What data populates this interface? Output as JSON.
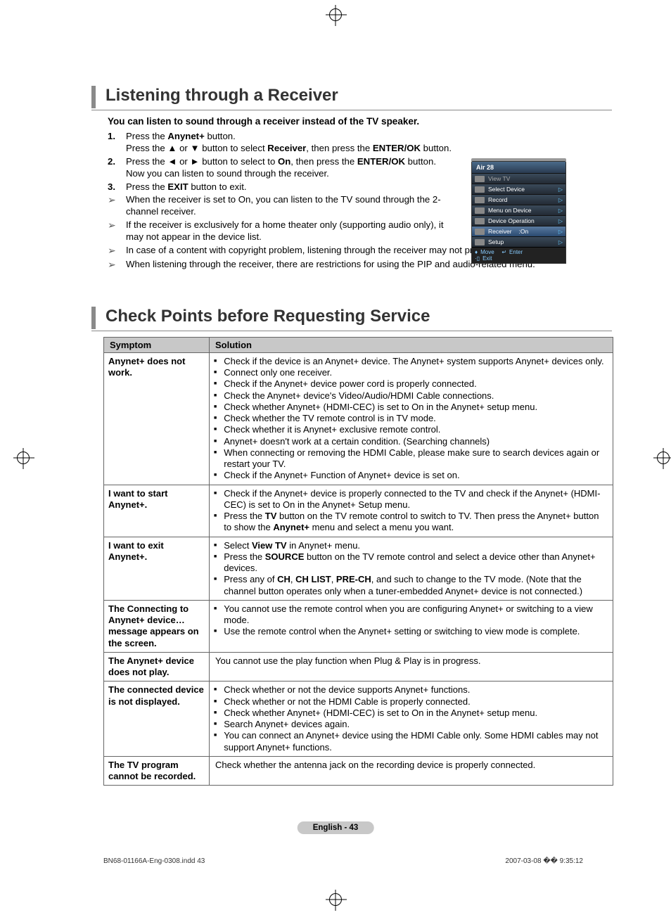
{
  "section1": {
    "title": "Listening through a Receiver",
    "intro": "You can listen to sound through a receiver instead of the TV speaker.",
    "steps": [
      {
        "num": "1.",
        "l1": "Press the ",
        "b1": "Anynet+",
        "l2": " button.",
        "l3": "Press the ▲ or ▼ button to select ",
        "b2": "Receiver",
        "l4": ", then press the ",
        "b3": "ENTER/OK",
        "l5": " button."
      },
      {
        "num": "2.",
        "l1": "Press the ◄ or ► button to select to ",
        "b1": "On",
        "l2": ", then press the ",
        "b2": "ENTER/OK",
        "l3": " button.",
        "l4": "Now you can listen to sound through the receiver."
      },
      {
        "num": "3.",
        "l1": "Press the ",
        "b1": "EXIT",
        "l2": " button to exit."
      }
    ],
    "notes": [
      "When the receiver is set to On, you can listen to the TV sound through the 2-channel receiver.",
      "If the receiver is exclusively for a home theater only (supporting audio only), it may not appear in the device list.",
      "In case of a content with copyright problem, listening through the receiver may not properly operate.",
      "When listening through the receiver, there are restrictions for using the PIP and audio-related menu."
    ]
  },
  "osd": {
    "title": "Air 28",
    "rows": [
      {
        "label": "View TV",
        "dim": true,
        "arrow": false
      },
      {
        "label": "Select Device",
        "arrow": true
      },
      {
        "label": "Record",
        "arrow": true
      },
      {
        "label": "Menu on Device",
        "arrow": true
      },
      {
        "label": "Device Operation",
        "arrow": true
      },
      {
        "label": "Receiver",
        "value": ":On",
        "arrow": true,
        "sel": true
      },
      {
        "label": "Setup",
        "arrow": true
      }
    ],
    "footer": {
      "move": "Move",
      "enter": "Enter",
      "exit": "Exit"
    }
  },
  "section2": {
    "title": "Check Points before Requesting Service",
    "th1": "Symptom",
    "th2": "Solution",
    "rows": [
      {
        "sym": "Anynet+ does not work.",
        "items": [
          "Check if the device is an Anynet+ device. The Anynet+ system supports Anynet+ devices only.",
          "Connect only one receiver.",
          "Check if the Anynet+ device power cord is properly connected.",
          "Check the Anynet+ device's Video/Audio/HDMI Cable connections.",
          "Check whether Anynet+ (HDMI-CEC) is set to On in the Anynet+ setup menu.",
          "Check whether the TV remote control is in TV mode.",
          "Check whether it is Anynet+ exclusive remote control.",
          "Anynet+ doesn't work at a certain condition. (Searching channels)",
          "When connecting or removing the HDMI Cable, please make sure to search devices again or restart your TV.",
          "Check if the Anynet+ Function of Anynet+ device is set on."
        ]
      },
      {
        "sym": "I want to start Anynet+.",
        "html": "start"
      },
      {
        "sym": "I want to exit Anynet+.",
        "html": "exit"
      },
      {
        "sym": "The Connecting to Anynet+ device… message appears on the screen.",
        "items": [
          "You cannot use the remote control when you are configuring Anynet+ or switching to a view mode.",
          "Use the remote control when the Anynet+ setting or switching to view mode is complete."
        ]
      },
      {
        "sym": "The Anynet+ device does not play.",
        "plain": "You cannot use the play function when Plug & Play is in progress."
      },
      {
        "sym": "The connected device is not displayed.",
        "items": [
          "Check whether or not the device supports Anynet+ functions.",
          "Check whether or not the HDMI Cable is properly connected.",
          "Check whether Anynet+ (HDMI-CEC) is set to On in the Anynet+ setup menu.",
          "Search Anynet+ devices again.",
          "You can connect an Anynet+ device using the HDMI Cable only. Some HDMI cables may not support Anynet+ functions."
        ]
      },
      {
        "sym": "The TV program cannot be recorded.",
        "plain": "Check whether the antenna jack on the recording device is properly connected."
      }
    ],
    "start_row": {
      "i1": "Check if the Anynet+ device is properly connected to the TV and check if the Anynet+ (HDMI-CEC) is set to On in the Anynet+ Setup menu.",
      "i2a": "Press the ",
      "i2b": "TV",
      "i2c": " button on the TV remote control to switch to TV. Then press the Anynet+ button to show the ",
      "i2d": "Anynet+",
      "i2e": " menu and select a menu you want."
    },
    "exit_row": {
      "i1a": "Select ",
      "i1b": "View TV",
      "i1c": " in Anynet+ menu.",
      "i2a": "Press the ",
      "i2b": "SOURCE",
      "i2c": " button on the TV remote control and select a device other than Anynet+ devices.",
      "i3a": "Press any of ",
      "i3b": "CH",
      "i3c": ", ",
      "i3d": "CH LIST",
      "i3e": ", ",
      "i3f": "PRE-CH",
      "i3g": ", and such to change to the TV mode. (Note that the channel button operates only when a tuner-embedded Anynet+ device is not connected.)"
    }
  },
  "page_badge": "English - 43",
  "footer": {
    "left": "BN68-01166A-Eng-0308.indd   43",
    "right": "2007-03-08   �� 9:35:12"
  }
}
